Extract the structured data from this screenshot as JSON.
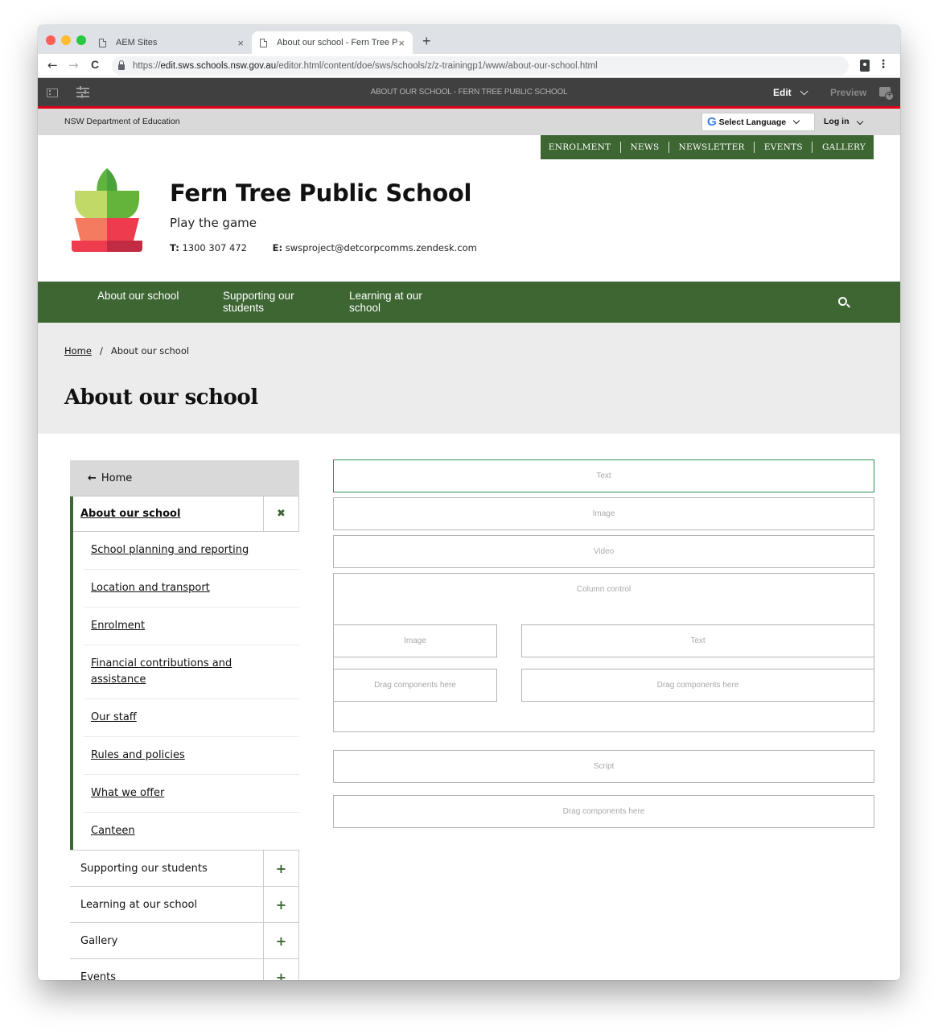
{
  "browser": {
    "tabs": [
      {
        "title": "AEM Sites",
        "active": false
      },
      {
        "title": "About our school - Fern Tree P",
        "active": true
      }
    ],
    "new_tab_label": "+",
    "close_glyph": "×",
    "url": {
      "scheme": "https://",
      "host": "edit.sws.schools.nsw.gov.au",
      "path": "/editor.html/content/doe/sws/schools/z/z-trainingp1/www/about-our-school.html"
    },
    "nav": {
      "back": "←",
      "forward": "→",
      "reload": "C"
    },
    "menu_glyph": "⋮"
  },
  "aem_toolbar": {
    "page_title": "ABOUT OUR SCHOOL - FERN TREE PUBLIC SCHOOL",
    "mode_label": "Edit",
    "preview_label": "Preview"
  },
  "site": {
    "department": "NSW Department of Education",
    "language_select": {
      "selected": "Select Language",
      "google_glyph": "G"
    },
    "login_label": "Log in",
    "utility_nav": [
      "ENROLMENT",
      "NEWS",
      "NEWSLETTER",
      "EVENTS",
      "GALLERY"
    ],
    "school": {
      "name": "Fern Tree Public School",
      "motto": "Play the game",
      "phone_label": "T:",
      "phone": "1300 307 472",
      "email_label": "E:",
      "email": "swsproject@detcorpcomms.zendesk.com"
    },
    "main_nav": [
      "About our school",
      "Supporting our students",
      "Learning at our school"
    ],
    "breadcrumb": {
      "home": "Home",
      "separator": "/",
      "current": "About our school"
    },
    "page_title": "About our school",
    "colors": {
      "brand_green": "#3d6633",
      "aem_red": "#e1001a",
      "selected_outline": "#2d8f5e"
    }
  },
  "side_nav": {
    "home": {
      "arrow": "🡐",
      "label": "Home"
    },
    "current": {
      "label": "About our school",
      "toggle": "✖"
    },
    "children": [
      "School planning and reporting",
      "Location and transport",
      "Enrolment",
      "Financial contributions and assistance",
      "Our staff",
      "Rules and policies",
      "What we offer",
      "Canteen"
    ],
    "sections": [
      {
        "label": "Supporting our students",
        "toggle": "+"
      },
      {
        "label": "Learning at our school",
        "toggle": "+"
      },
      {
        "label": "Gallery",
        "toggle": "+"
      },
      {
        "label": "Events",
        "toggle": "+"
      }
    ]
  },
  "editor": {
    "components": {
      "text": "Text",
      "image": "Image",
      "video": "Video",
      "column_control": "Column control",
      "col_image": "Image",
      "col_text": "Text",
      "col_drag_left": "Drag components here",
      "col_drag_right": "Drag components here",
      "script": "Script",
      "drag_bottom": "Drag components here"
    }
  }
}
